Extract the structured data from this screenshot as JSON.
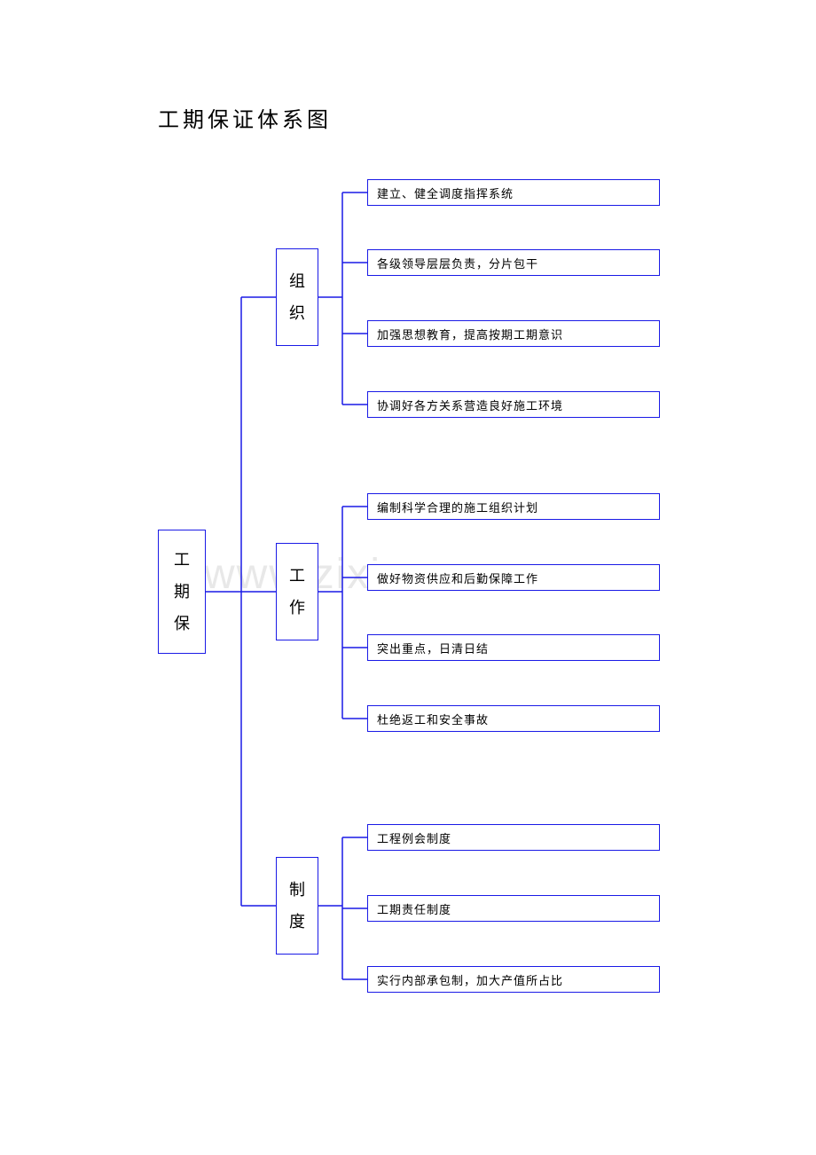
{
  "title": "工期保证体系图",
  "watermark": "www.zixin.com.cn",
  "root": {
    "l1": "工",
    "l2": "期",
    "l3": "保"
  },
  "groups": [
    {
      "label": {
        "l1": "组",
        "l2": "织"
      },
      "items": [
        "建立、健全调度指挥系统",
        "各级领导层层负责，分片包干",
        "加强思想教育，提高按期工期意识",
        "协调好各方关系营造良好施工环境"
      ]
    },
    {
      "label": {
        "l1": "工",
        "l2": "作"
      },
      "items": [
        "编制科学合理的施工组织计划",
        "做好物资供应和后勤保障工作",
        "突出重点，日清日结",
        "杜绝返工和安全事故"
      ]
    },
    {
      "label": {
        "l1": "制",
        "l2": "度"
      },
      "items": [
        "工程例会制度",
        "工期责任制度",
        "实行内部承包制，加大产值所占比"
      ]
    }
  ]
}
